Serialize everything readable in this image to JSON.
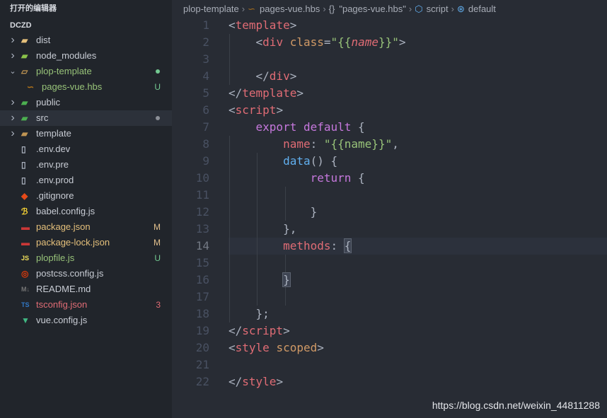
{
  "sidebar": {
    "open_editors": "打开的编辑器",
    "project": "DCZD",
    "items": [
      {
        "label": "dist",
        "indent": 1,
        "chevron": "right",
        "icon": "folder-icon",
        "icon_color": "#e5c07b",
        "color": "#c8ccd4",
        "badge": "",
        "dot": ""
      },
      {
        "label": "node_modules",
        "indent": 1,
        "chevron": "right",
        "icon": "node-folder-icon",
        "icon_color": "#8bc34a",
        "color": "#c8ccd4",
        "badge": "",
        "dot": ""
      },
      {
        "label": "plop-template",
        "indent": 1,
        "chevron": "down",
        "icon": "folder-open-icon",
        "icon_color": "#c09553",
        "color": "#98c379",
        "badge": "",
        "dot": "#73c991"
      },
      {
        "label": "pages-vue.hbs",
        "indent": 2,
        "chevron": "",
        "icon": "handlebars-icon",
        "icon_color": "#b07219",
        "color": "#98c379",
        "badge": "U",
        "badge_color": "#73c991",
        "dot": ""
      },
      {
        "label": "public",
        "indent": 1,
        "chevron": "right",
        "icon": "public-folder-icon",
        "icon_color": "#4caf50",
        "color": "#c8ccd4",
        "badge": "",
        "dot": ""
      },
      {
        "label": "src",
        "indent": 1,
        "chevron": "right",
        "icon": "src-folder-icon",
        "icon_color": "#4caf50",
        "color": "#c8ccd4",
        "badge": "",
        "dot": "#8b8f97",
        "highlight": true
      },
      {
        "label": "template",
        "indent": 1,
        "chevron": "right",
        "icon": "folder-icon",
        "icon_color": "#c09553",
        "color": "#c8ccd4",
        "badge": "",
        "dot": ""
      },
      {
        "label": ".env.dev",
        "indent": 1,
        "chevron": "",
        "icon": "file-icon",
        "icon_color": "#abb2bf",
        "color": "#c8ccd4",
        "badge": "",
        "dot": ""
      },
      {
        "label": ".env.pre",
        "indent": 1,
        "chevron": "",
        "icon": "file-icon",
        "icon_color": "#abb2bf",
        "color": "#c8ccd4",
        "badge": "",
        "dot": ""
      },
      {
        "label": ".env.prod",
        "indent": 1,
        "chevron": "",
        "icon": "file-icon",
        "icon_color": "#abb2bf",
        "color": "#c8ccd4",
        "badge": "",
        "dot": ""
      },
      {
        "label": ".gitignore",
        "indent": 1,
        "chevron": "",
        "icon": "git-icon",
        "icon_color": "#e64a19",
        "color": "#c8ccd4",
        "badge": "",
        "dot": ""
      },
      {
        "label": "babel.config.js",
        "indent": 1,
        "chevron": "",
        "icon": "babel-icon",
        "icon_color": "#fdd835",
        "color": "#c8ccd4",
        "badge": "",
        "dot": ""
      },
      {
        "label": "package.json",
        "indent": 1,
        "chevron": "",
        "icon": "npm-icon",
        "icon_color": "#cb3837",
        "color": "#e5c07b",
        "badge": "M",
        "badge_color": "#e2c08d",
        "dot": ""
      },
      {
        "label": "package-lock.json",
        "indent": 1,
        "chevron": "",
        "icon": "npm-icon",
        "icon_color": "#cb3837",
        "color": "#e5c07b",
        "badge": "M",
        "badge_color": "#e2c08d",
        "dot": ""
      },
      {
        "label": "plopfile.js",
        "indent": 1,
        "chevron": "",
        "icon": "js-icon",
        "icon_color": "#f1e05a",
        "color": "#98c379",
        "badge": "U",
        "badge_color": "#73c991",
        "dot": ""
      },
      {
        "label": "postcss.config.js",
        "indent": 1,
        "chevron": "",
        "icon": "postcss-icon",
        "icon_color": "#dd3a0a",
        "color": "#c8ccd4",
        "badge": "",
        "dot": ""
      },
      {
        "label": "README.md",
        "indent": 1,
        "chevron": "",
        "icon": "markdown-icon",
        "icon_color": "#757575",
        "color": "#c8ccd4",
        "badge": "",
        "dot": ""
      },
      {
        "label": "tsconfig.json",
        "indent": 1,
        "chevron": "",
        "icon": "typescript-icon",
        "icon_color": "#3178c6",
        "color": "#e06c75",
        "badge": "3",
        "badge_color": "#e06c75",
        "dot": ""
      },
      {
        "label": "vue.config.js",
        "indent": 1,
        "chevron": "",
        "icon": "vue-icon",
        "icon_color": "#41b883",
        "color": "#c8ccd4",
        "badge": "",
        "dot": ""
      }
    ]
  },
  "breadcrumb": {
    "folder": "plop-template",
    "file": "pages-vue.hbs",
    "block_icon": "{}",
    "block": "\"pages-vue.hbs\"",
    "script": "script",
    "default": "default"
  },
  "editor": {
    "line_numbers": [
      "1",
      "2",
      "3",
      "4",
      "5",
      "6",
      "7",
      "8",
      "9",
      "10",
      "11",
      "12",
      "13",
      "14",
      "15",
      "16",
      "17",
      "18",
      "19",
      "20",
      "21",
      "22"
    ],
    "current_line": 14
  },
  "watermark": "https://blog.csdn.net/weixin_44811288"
}
